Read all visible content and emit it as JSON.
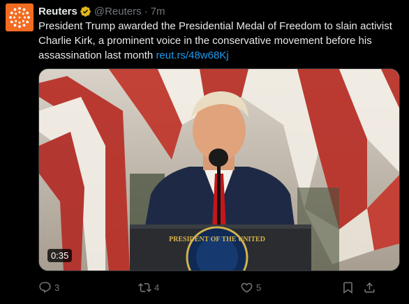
{
  "author": {
    "display_name": "Reuters",
    "handle": "@Reuters",
    "separator": "·",
    "time": "7m",
    "avatar_color": "#f36c21"
  },
  "tweet": {
    "text": "President Trump awarded the Presidential Medal of Freedom to slain activist Charlie Kirk, a prominent voice in the conservative movement before his assassination last month",
    "link": "reut.rs/48w68Kj"
  },
  "media": {
    "duration": "0:35",
    "seal_text": "PRESIDENT OF THE UNITED"
  },
  "actions": {
    "replies": "3",
    "reposts": "4",
    "likes": "5"
  },
  "icons": [
    "reuters-logo-icon",
    "verified-badge-icon",
    "reply-icon",
    "repost-icon",
    "like-icon",
    "bookmark-icon",
    "share-icon"
  ],
  "colors": {
    "background": "#000000",
    "text": "#e7e9ea",
    "secondary": "#71767b",
    "link": "#1d9bf0",
    "verified_gold": "#e2b719"
  }
}
